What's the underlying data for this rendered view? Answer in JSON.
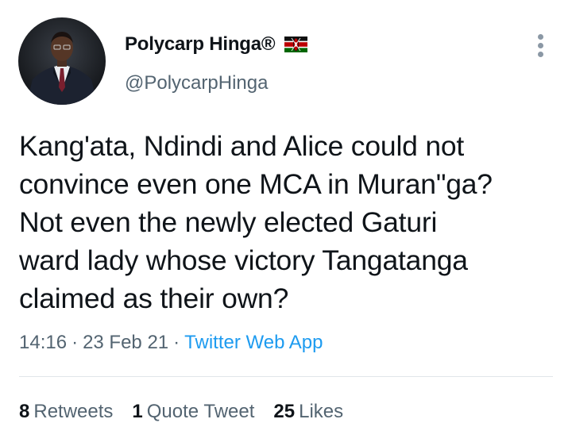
{
  "author": {
    "display_name": "Polycarp Hinga®",
    "handle": "@PolycarpHinga",
    "badge_icon": "kenya-flag-icon",
    "avatar_icon": "profile-photo"
  },
  "tweet": {
    "lines": [
      "Kang'ata, Ndindi and Alice could not",
      "convince even one MCA in Muran\"ga?",
      "Not even the newly elected Gaturi",
      "ward lady whose victory Tangatanga",
      "claimed as their own?"
    ],
    "time": "14:16",
    "date": "23 Feb 21",
    "separator": "·",
    "source": "Twitter Web App"
  },
  "stats": {
    "retweets": {
      "count": "8",
      "label": "Retweets"
    },
    "quotes": {
      "count": "1",
      "label": "Quote Tweet"
    },
    "likes": {
      "count": "25",
      "label": "Likes"
    }
  },
  "colors": {
    "text": "#0f1419",
    "secondary": "#536471",
    "link": "#1d9bf0",
    "divider": "#e1e6ea"
  },
  "more_icon": "more-options-icon"
}
